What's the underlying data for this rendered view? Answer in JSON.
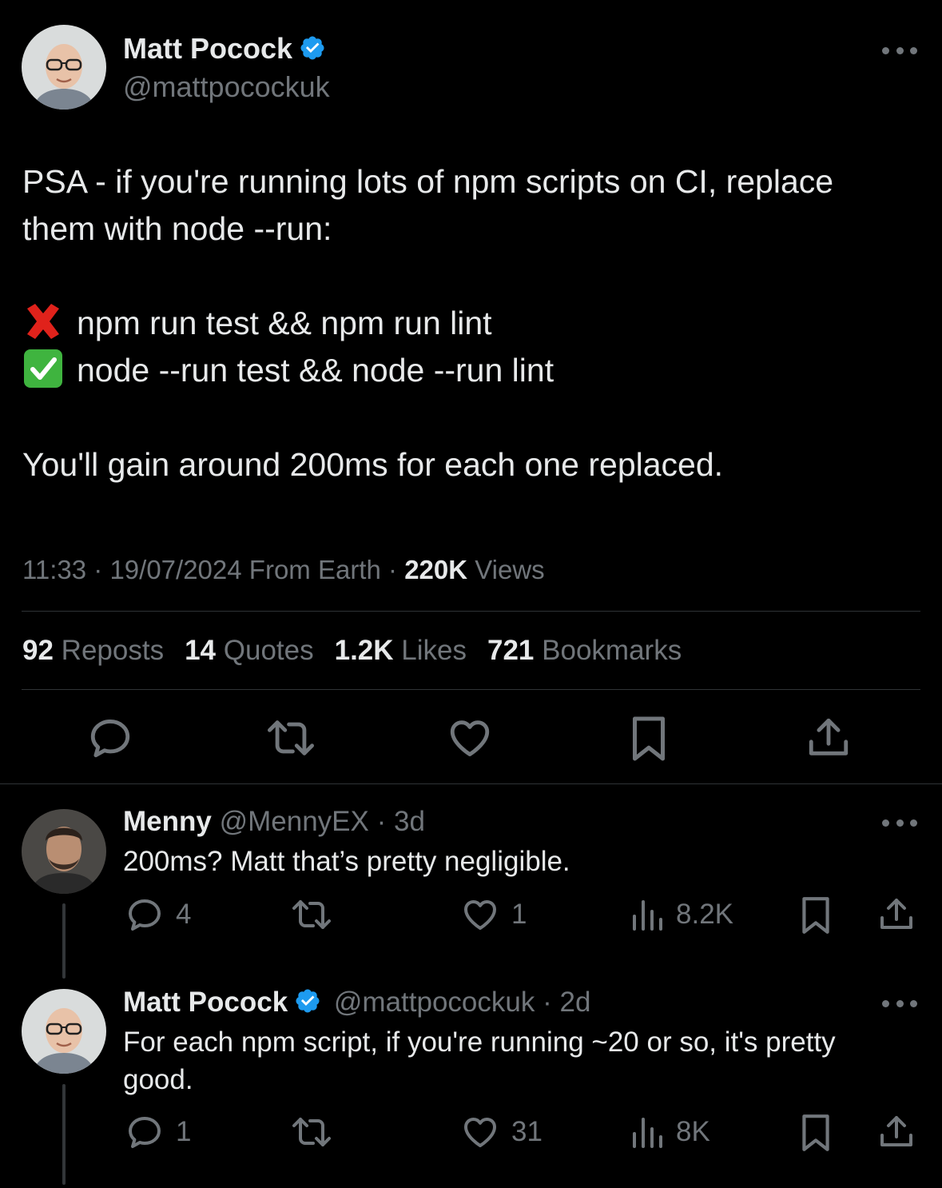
{
  "main_tweet": {
    "author_name": "Matt Pocock",
    "author_handle": "@mattpocockuk",
    "text_lines": [
      "PSA - if you're running lots of npm scripts on CI, replace",
      "them with node --run:",
      "npm run test && npm run lint",
      "node --run test && node --run lint",
      "You'll gain around 200ms for each one replaced."
    ],
    "timestamp": "11:33 · 19/07/2024",
    "source": "From Earth",
    "separator": "·",
    "views_count": "220K",
    "views_label": "Views",
    "stats": {
      "reposts_count": "92",
      "reposts_label": "Reposts",
      "quotes_count": "14",
      "quotes_label": "Quotes",
      "likes_count": "1.2K",
      "likes_label": "Likes",
      "bookmarks_count": "721",
      "bookmarks_label": "Bookmarks"
    }
  },
  "replies": [
    {
      "author_name": "Menny",
      "author_handle": "@MennyEX",
      "time": "· 3d",
      "text_lines": [
        "200ms? Matt that’s pretty negligible."
      ],
      "reply_count": "4",
      "like_count": "1",
      "view_count": "8.2K"
    },
    {
      "author_name": "Matt Pocock",
      "author_handle": "@mattpocockuk",
      "time": "· 2d",
      "text_lines": [
        "For each npm script, if you're running ~20 or so, it's pretty",
        "good."
      ],
      "reply_count": "1",
      "like_count": "31",
      "view_count": "8K"
    }
  ],
  "colors": {
    "background": "#000000",
    "text": "#e7e9ea",
    "muted": "#71767b",
    "divider": "#2f3336",
    "verified": "#1d9bf0",
    "cross": "#e0221b",
    "check": "#3fb43f"
  },
  "icons": [
    "verified-badge-icon",
    "more-icon",
    "cross-mark-icon",
    "check-mark-icon",
    "reply-icon",
    "repost-icon",
    "like-icon",
    "bookmark-icon",
    "share-icon",
    "views-icon"
  ]
}
